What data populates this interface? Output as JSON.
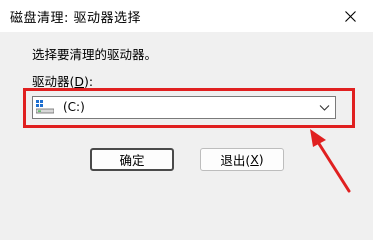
{
  "window": {
    "title": "磁盘清理: 驱动器选择",
    "close_icon": "close-icon"
  },
  "dialog": {
    "instruction": "选择要清理的驱动器。",
    "drive_label_prefix": "驱动器(",
    "drive_label_accel": "D",
    "drive_label_suffix": "):",
    "drive_select": {
      "selected_value": "(C:)",
      "icon": "drive-icon"
    },
    "ok_button": "确定",
    "exit_button_prefix": "退出(",
    "exit_button_accel": "X",
    "exit_button_suffix": ")"
  },
  "annotation": {
    "highlight_color": "#e02020"
  }
}
